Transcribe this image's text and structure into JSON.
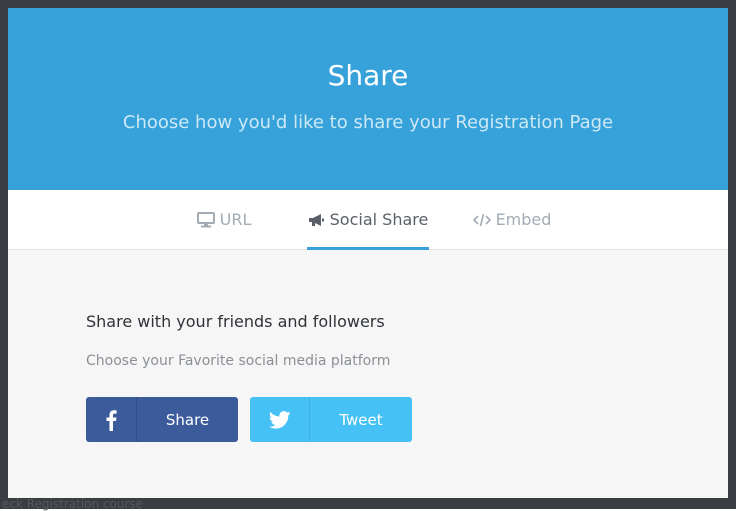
{
  "backdrop": {
    "partial_text": "eck Registration course"
  },
  "modal": {
    "title": "Share",
    "subtitle": "Choose how you'd like to share your Registration Page"
  },
  "tabs": [
    {
      "label": "URL",
      "icon": "monitor-icon",
      "active": false
    },
    {
      "label": "Social Share",
      "icon": "megaphone-icon",
      "active": true
    },
    {
      "label": "Embed",
      "icon": "code-icon",
      "active": false
    }
  ],
  "content": {
    "heading": "Share with your friends and followers",
    "subheading": "Choose your Favorite social media platform",
    "buttons": [
      {
        "label": "Share",
        "icon": "facebook-icon",
        "color": "#3c5b9a"
      },
      {
        "label": "Tweet",
        "icon": "twitter-icon",
        "color": "#45c1f5"
      }
    ]
  },
  "colors": {
    "accent": "#36a2d9",
    "backdrop": "#3a3d42",
    "body_bg": "#f6f6f6"
  }
}
